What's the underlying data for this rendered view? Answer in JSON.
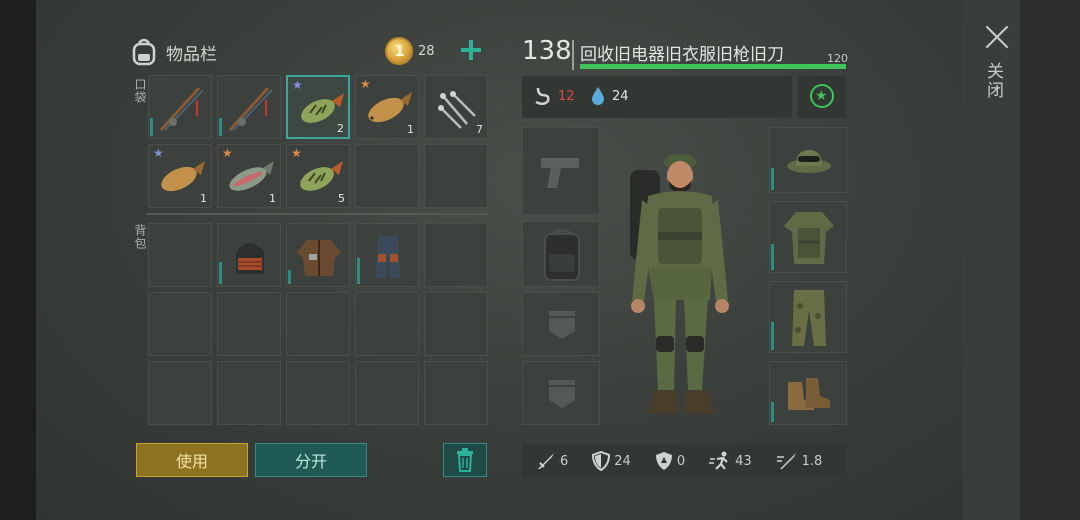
{
  "window": {
    "close_label": "关闭"
  },
  "inventory": {
    "title": "物品栏",
    "coins": "28",
    "pocket_label": "口袋",
    "backpack_label": "背包",
    "pocket_slots": [
      {
        "item": "fishing-rod",
        "qty": "",
        "star": ""
      },
      {
        "item": "fishing-rod",
        "qty": "",
        "star": ""
      },
      {
        "item": "perch-fish",
        "qty": "2",
        "star": "blue"
      },
      {
        "item": "carp-fish",
        "qty": "1",
        "star": "orange"
      },
      {
        "item": "nails",
        "qty": "7",
        "star": ""
      },
      {
        "item": "carp-fish",
        "qty": "1",
        "star": "blue"
      },
      {
        "item": "trout-fish",
        "qty": "1",
        "star": "orange"
      },
      {
        "item": "perch-fish",
        "qty": "5",
        "star": "orange"
      },
      {
        "item": "",
        "qty": "",
        "star": ""
      },
      {
        "item": "",
        "qty": "",
        "star": ""
      }
    ],
    "backpack_slots": [
      {
        "item": "",
        "qty": ""
      },
      {
        "item": "helmet",
        "qty": ""
      },
      {
        "item": "leather-jacket",
        "qty": ""
      },
      {
        "item": "leather-pants",
        "qty": ""
      },
      {
        "item": "",
        "qty": ""
      }
    ]
  },
  "buttons": {
    "use_label": "使用",
    "split_label": "分开"
  },
  "character": {
    "level": "138",
    "name": "回收旧电器旧衣服旧枪旧刀",
    "xp_max": "120",
    "xp_progress": 1.0,
    "hunger": "12",
    "thirst": "24",
    "stats": {
      "damage": "6",
      "defense": "24",
      "armor": "0",
      "speed": "43",
      "attack_speed": "1.8"
    }
  },
  "colors": {
    "accent_teal": "#2e8c80",
    "use_gold": "#8d7220",
    "xp_green": "#3ec45a",
    "hunger_red": "#e0483c",
    "star_blue": "#7f8fd8",
    "star_orange": "#d98a4a"
  }
}
